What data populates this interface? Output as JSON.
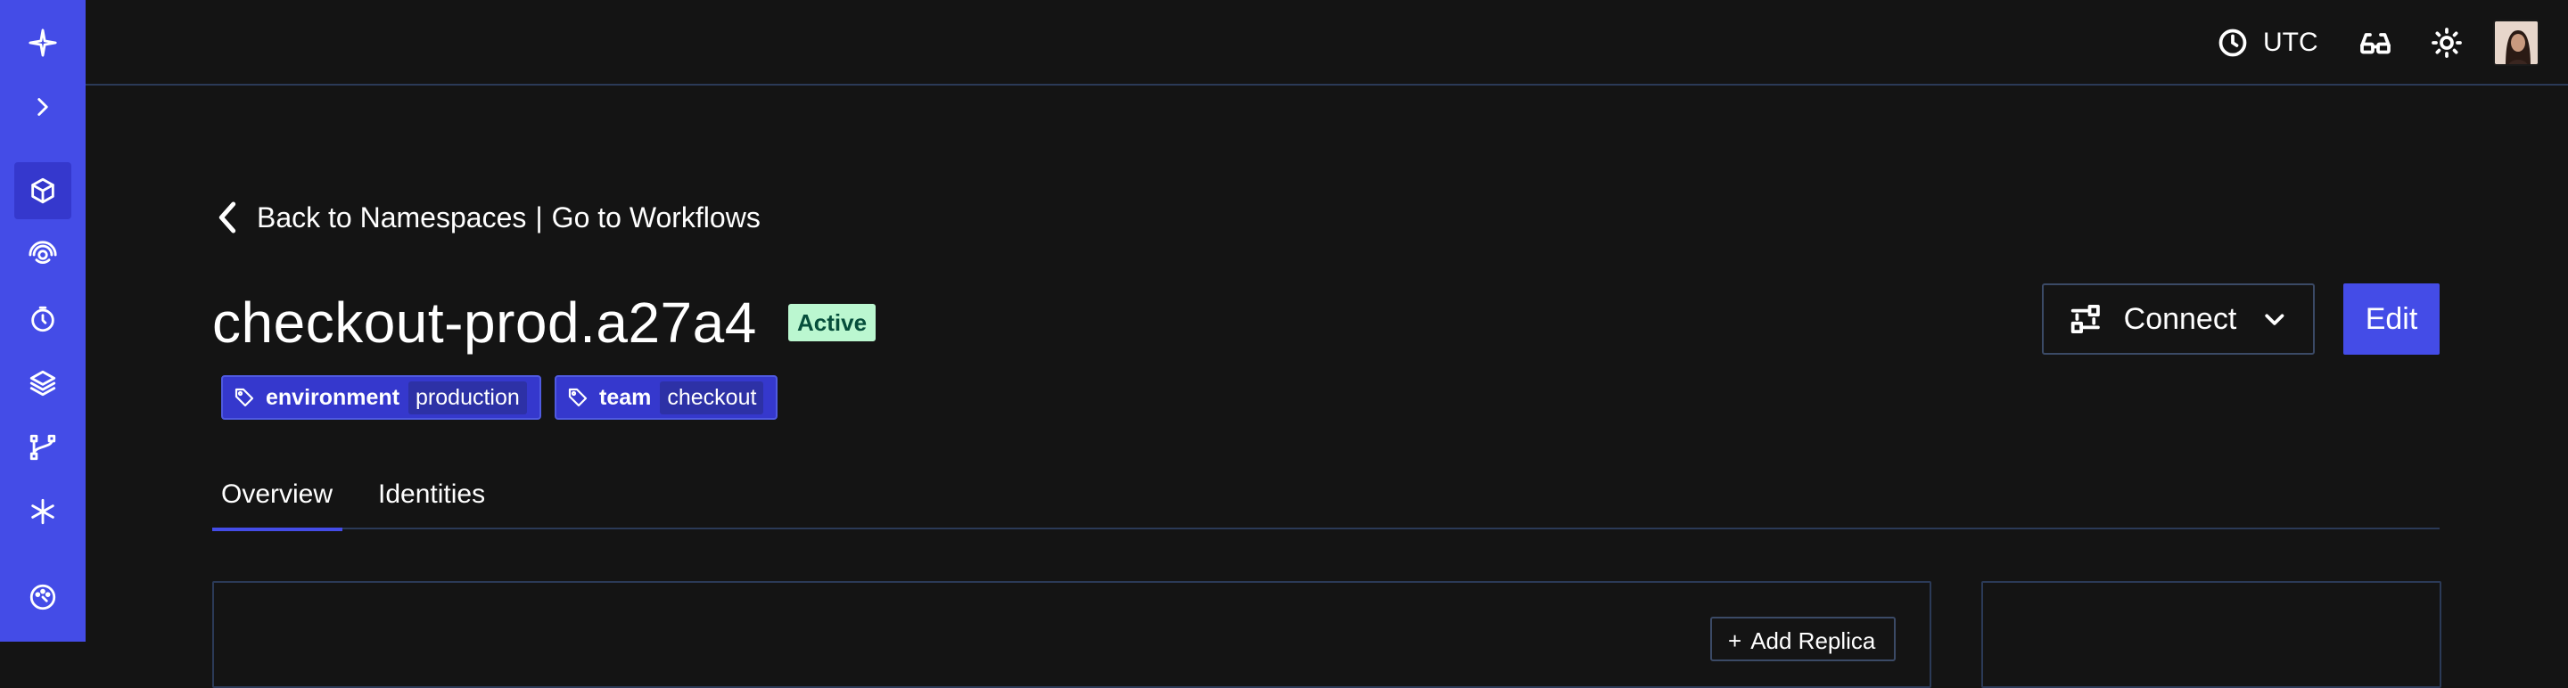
{
  "sidebar": {
    "items": [
      {
        "icon": "logo-icon",
        "label": ""
      },
      {
        "icon": "chevron-right-icon",
        "label": ""
      },
      {
        "icon": "box-icon",
        "label": ""
      },
      {
        "icon": "radar-icon",
        "label": ""
      },
      {
        "icon": "timer-icon",
        "label": ""
      },
      {
        "icon": "layers-icon",
        "label": ""
      },
      {
        "icon": "git-branch-icon",
        "label": ""
      },
      {
        "icon": "asterisk-icon",
        "label": ""
      },
      {
        "icon": "palette-icon",
        "label": ""
      }
    ],
    "accent": "#444ce7"
  },
  "topbar": {
    "timezone": "UTC"
  },
  "back_link": {
    "back_label": "Back to Namespaces",
    "separator": "|",
    "workflows_label": "Go to Workflows"
  },
  "namespace": {
    "name": "checkout-prod.a27a4",
    "status": "Active"
  },
  "tags": [
    {
      "key": "environment",
      "value": "production"
    },
    {
      "key": "team",
      "value": "checkout"
    }
  ],
  "actions": {
    "connect_label": "Connect",
    "edit_label": "Edit"
  },
  "tabs": [
    {
      "label": "Overview",
      "active": true
    },
    {
      "label": "Identities",
      "active": false
    }
  ],
  "replica": {
    "add_label": "Add Replica"
  }
}
